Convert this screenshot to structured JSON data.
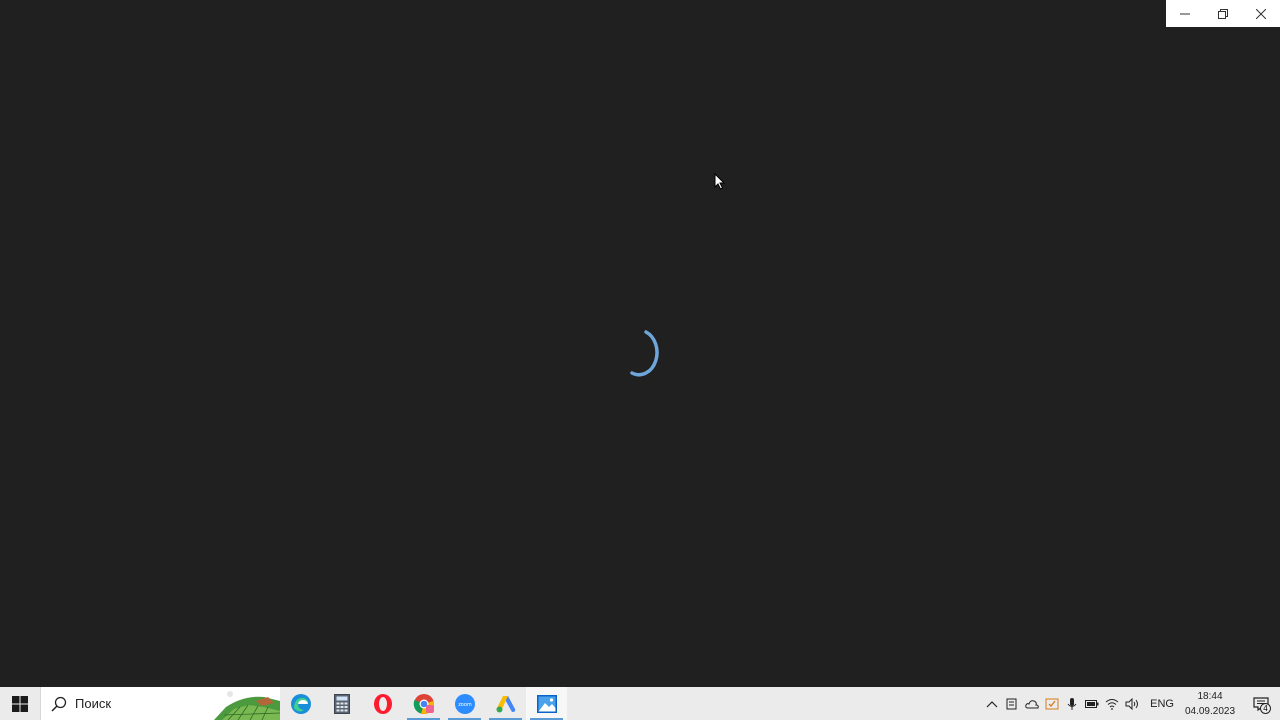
{
  "window": {
    "controls": {
      "minimize_icon": "minimize-icon",
      "restore_icon": "restore-icon",
      "close_icon": "close-icon"
    },
    "background": "#202020",
    "spinner_color": "#6ea6dc"
  },
  "taskbar": {
    "start_icon": "windows-logo-icon",
    "search": {
      "placeholder": "Поиск"
    },
    "pinned_apps": [
      {
        "name": "Microsoft Edge",
        "icon": "edge-icon"
      },
      {
        "name": "Calculator",
        "icon": "calculator-icon"
      },
      {
        "name": "Opera",
        "icon": "opera-icon"
      },
      {
        "name": "Google Chrome",
        "icon": "chrome-icon"
      },
      {
        "name": "Zoom",
        "icon": "zoom-icon",
        "label": "zoom"
      },
      {
        "name": "Google Ads",
        "icon": "google-ads-icon"
      },
      {
        "name": "Photos",
        "icon": "photos-icon"
      }
    ],
    "tray": {
      "icons": [
        "chevron-up-icon",
        "meet-now-icon",
        "onedrive-icon",
        "security-icon",
        "microphone-icon",
        "battery-icon",
        "wifi-icon",
        "volume-icon"
      ],
      "language": "ENG",
      "time": "18:44",
      "date": "04.09.2023",
      "notifications_count": "4"
    }
  }
}
